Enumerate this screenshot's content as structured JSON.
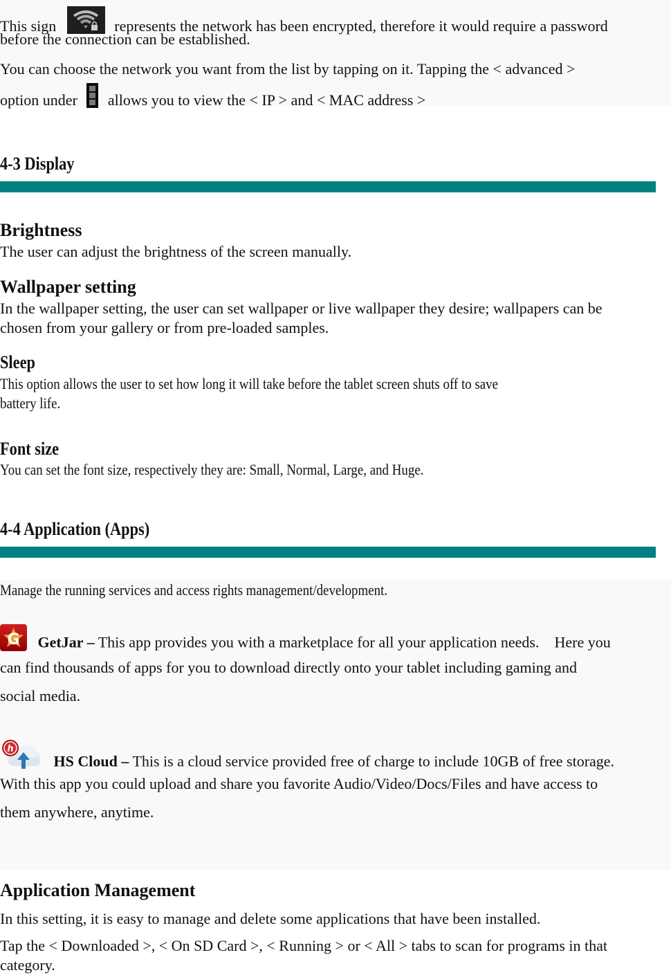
{
  "colors": {
    "accent_bar": "#008080",
    "box_background": "#f9f9f9",
    "text": "#111111"
  },
  "wifi_section": {
    "line1_pre": "This sign",
    "line1_post": "represents the network has been encrypted, therefore it would require a password",
    "line2": "before the connection can be established.",
    "line3": "You can choose the network you want from the list by tapping on it. Tapping the < advanced >",
    "line4_pre": "option under",
    "line4_post": "allows you to view the < IP > and < MAC address >",
    "icons": [
      "wifi-lock-icon",
      "overflow-menu-icon"
    ]
  },
  "display_section": {
    "heading": "4-3 Display",
    "items": [
      {
        "title": "Brightness",
        "lines": [
          "The user can adjust the brightness of the screen manually."
        ]
      },
      {
        "title": "Wallpaper setting",
        "lines": [
          "In the wallpaper setting, the user can set wallpaper or live wallpaper they desire; wallpapers can be",
          "chosen from your gallery or from pre-loaded samples."
        ]
      },
      {
        "title": "Sleep",
        "lines": [
          "This option allows the user to set how long it will take before the tablet screen shuts off to save",
          "battery life."
        ]
      },
      {
        "title": "Font size",
        "lines": [
          "You can set the font size, respectively they are: Small, Normal, Large, and Huge."
        ]
      }
    ]
  },
  "apps_section": {
    "heading": "4-4 Application (Apps)",
    "intro": "Manage the running services and access rights management/development.",
    "apps": [
      {
        "icon": "getjar-icon",
        "name": "GetJar –",
        "lines": [
          "This app provides you with a marketplace for all your application needs.    Here you",
          "can find thousands of apps for you to download directly onto your tablet including gaming and",
          "social media."
        ]
      },
      {
        "icon": "hs-cloud-icon",
        "name": "HS Cloud –",
        "lines": [
          "This is a cloud service provided free of charge to include 10GB of free storage.",
          "With this app you could upload and share you favorite Audio/Video/Docs/Files and have access to",
          "them anywhere, anytime."
        ]
      }
    ]
  },
  "app_management": {
    "title": "Application Management",
    "lines": [
      "In this setting, it is easy to manage and delete some applications that have been installed.",
      "Tap the < Downloaded >, < On SD Card >, < Running > or < All > tabs to scan for programs in that",
      "category."
    ]
  }
}
